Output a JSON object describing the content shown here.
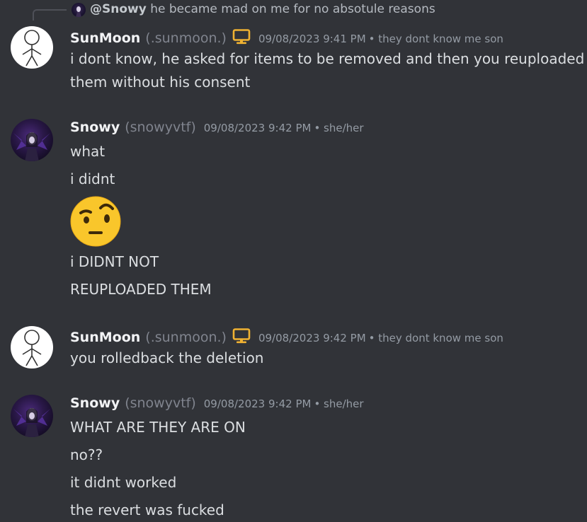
{
  "reply": {
    "username": "@Snowy",
    "text": "he became mad on me for no absotule reasons"
  },
  "messages": [
    {
      "author": "SunMoon",
      "handle": "(.sunmoon.)",
      "timestamp": "09/08/2023 9:41 PM",
      "pronouns": "• they dont know me son",
      "lines": [
        "i dont know, he asked for items to be removed and then you reuploaded",
        "them without his consent"
      ]
    },
    {
      "author": "Snowy",
      "handle": "(snowyvtf)",
      "timestamp": "09/08/2023 9:42 PM",
      "pronouns": "• she/her",
      "lines": [
        "what",
        "i didnt",
        "i DIDNT NOT",
        "REUPLOADED THEM"
      ]
    },
    {
      "author": "SunMoon",
      "handle": "(.sunmoon.)",
      "timestamp": "09/08/2023 9:42 PM",
      "pronouns": "• they dont know me son",
      "lines": [
        "you rolledback the deletion"
      ]
    },
    {
      "author": "Snowy",
      "handle": "(snowyvtf)",
      "timestamp": "09/08/2023 9:42 PM",
      "pronouns": "• she/her",
      "lines": [
        "WHAT ARE THEY ARE ON",
        "no??",
        "it didnt worked",
        "the revert was fucked"
      ]
    }
  ],
  "colors": {
    "background": "#313338",
    "username": "#f2f3f5",
    "handle": "#80848e",
    "timestamp": "#949ba4",
    "text": "#dbdee1",
    "monitor_icon": "#f0b232"
  },
  "icons": {
    "monitor": "desktop-monitor-icon",
    "emoji": "face-with-raised-eyebrow-emoji"
  }
}
